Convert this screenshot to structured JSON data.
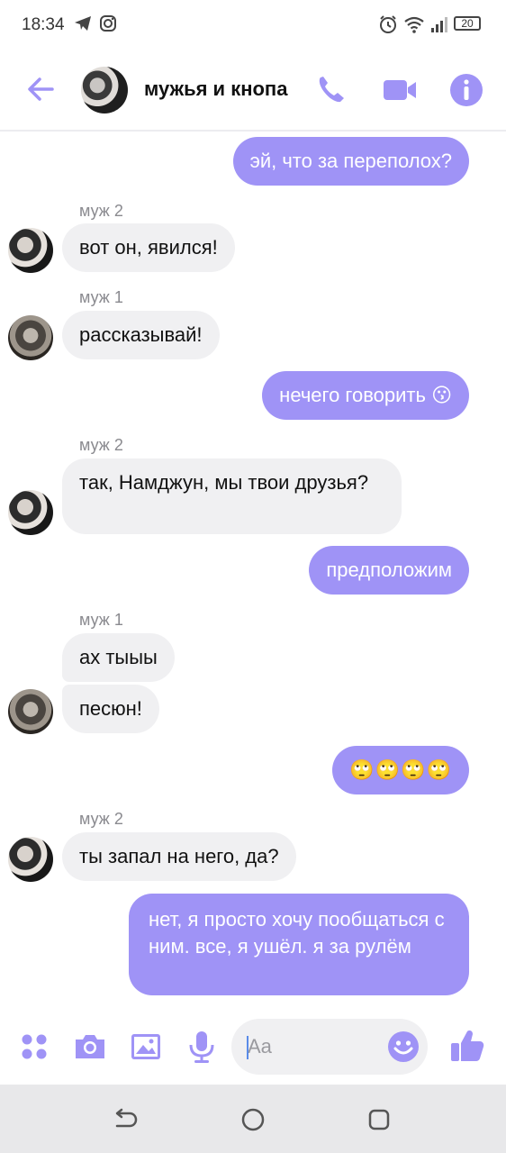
{
  "status_bar": {
    "time": "18:34",
    "battery": "20",
    "icons": [
      "telegram-icon",
      "instagram-icon",
      "alarm-icon",
      "wifi-icon",
      "signal-icon",
      "battery-icon"
    ]
  },
  "header": {
    "title": "мужья и кнопа",
    "icons": [
      "back-arrow-icon",
      "phone-icon",
      "video-camera-icon",
      "info-icon"
    ]
  },
  "messages": [
    {
      "dir": "out",
      "text": "эй, что за переполох?"
    },
    {
      "dir": "in",
      "sender": "муж 2",
      "text": "вот он, явился!"
    },
    {
      "dir": "in",
      "sender": "муж 1",
      "text": "рассказывай!"
    },
    {
      "dir": "out",
      "text": "нечего говорить",
      "emoji": "😗"
    },
    {
      "dir": "in",
      "sender": "муж 2",
      "text": "так, Намджун, мы твои друзья?"
    },
    {
      "dir": "out",
      "text": "предположим"
    },
    {
      "dir": "in",
      "sender": "муж 1",
      "text": "ах тыыы"
    },
    {
      "dir": "in",
      "text": "песюн!"
    },
    {
      "dir": "out",
      "text": "🙄🙄🙄🙄"
    },
    {
      "dir": "in",
      "sender": "муж 2",
      "text": "ты запал на него, да?"
    },
    {
      "dir": "out",
      "text": "нет, я просто хочу пообщаться с ним. все, я ушёл. я за рулём"
    }
  ],
  "composer": {
    "placeholder": "Aa",
    "icons": [
      "apps-grid-icon",
      "camera-icon",
      "image-icon",
      "microphone-icon",
      "emoji-icon",
      "thumbs-up-icon"
    ]
  },
  "nav_bar": {
    "icons": [
      "back-nav-icon",
      "home-nav-icon",
      "recents-nav-icon"
    ]
  },
  "colors": {
    "accent": "#9f93f6",
    "incoming_bubble": "#f0f0f2",
    "sender_label": "#8a8a8f"
  }
}
